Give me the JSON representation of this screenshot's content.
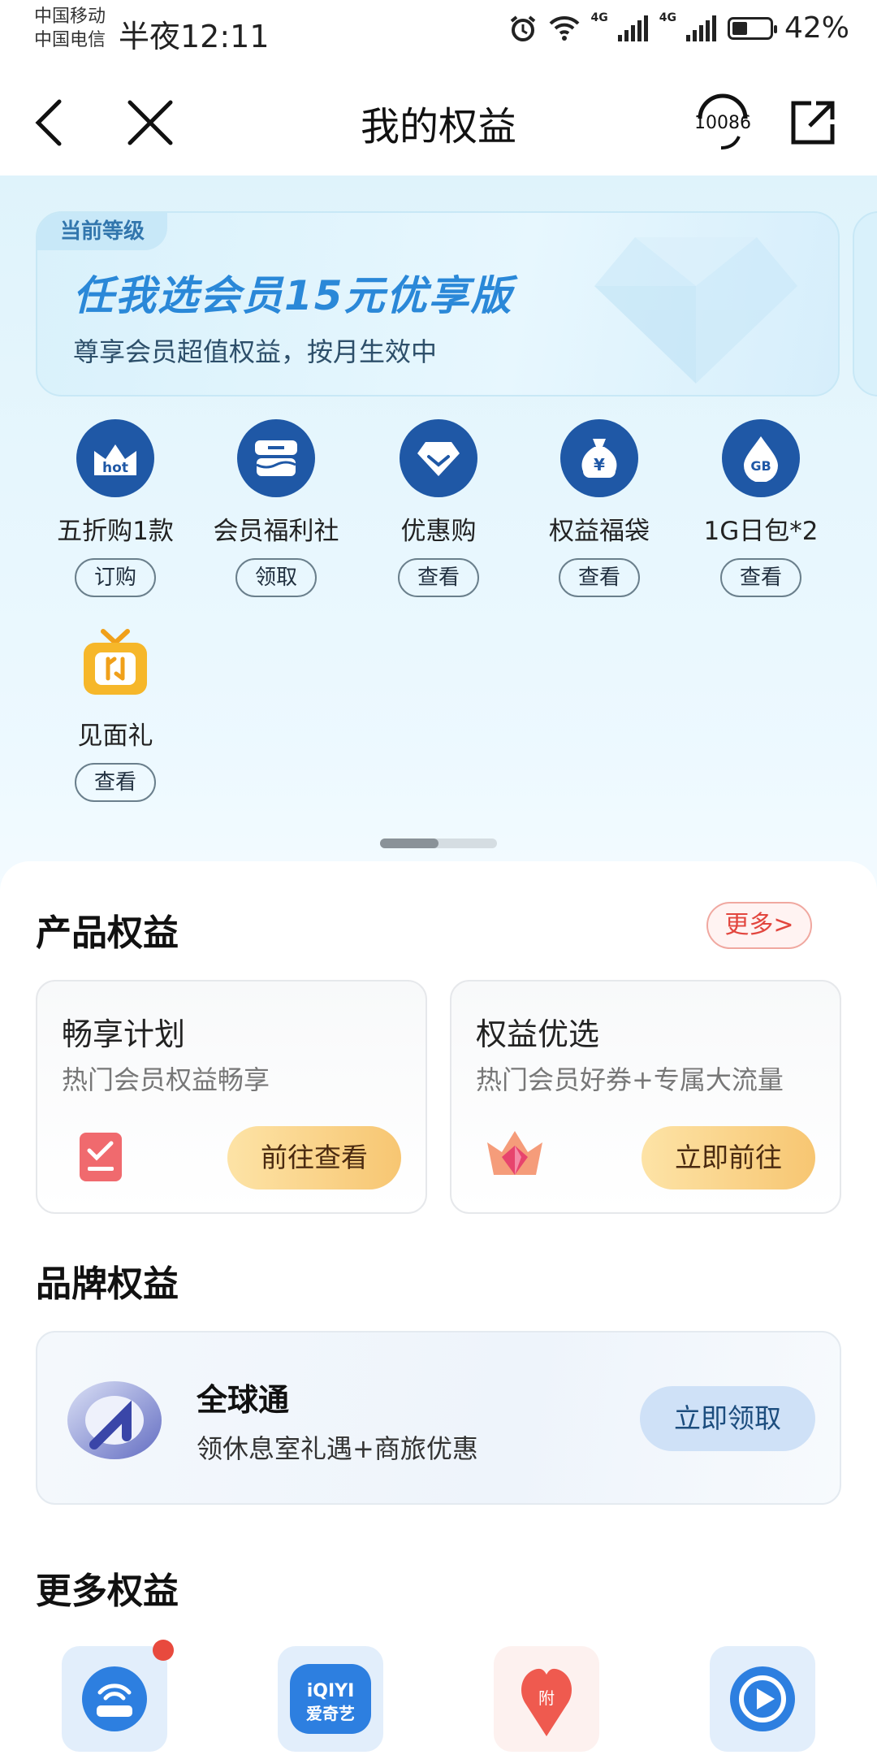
{
  "status_bar": {
    "carrier_1": "中国移动",
    "carrier_2": "中国电信",
    "time": "半夜12:11",
    "network_1": "4G",
    "network_2": "4G",
    "battery_text": "42%",
    "battery_level": 0.42
  },
  "nav": {
    "title": "我的权益",
    "service_number": "10086"
  },
  "level_card": {
    "tag": "当前等级",
    "name": "任我选会员15元优享版",
    "description": "尊享会员超值权益，按月生效中"
  },
  "benefits": [
    {
      "label": "五折购1款",
      "button": "订购",
      "icon": "hot-crown-icon",
      "icon_text": "hot"
    },
    {
      "label": "会员福利社",
      "button": "领取",
      "icon": "gift-box-icon"
    },
    {
      "label": "优惠购",
      "button": "查看",
      "icon": "diamond-icon"
    },
    {
      "label": "权益福袋",
      "button": "查看",
      "icon": "money-bag-icon",
      "icon_text": "¥"
    },
    {
      "label": "1G日包*2",
      "button": "查看",
      "icon": "data-drop-icon",
      "icon_text": "GB"
    },
    {
      "label": "见面礼",
      "button": "查看",
      "icon": "gift-icon"
    }
  ],
  "pager": {
    "pages": 2,
    "current": 1
  },
  "product_section": {
    "title": "产品权益",
    "more_label": "更多>",
    "cards": [
      {
        "title": "畅享计划",
        "description": "热门会员权益畅享",
        "button": "前往查看",
        "icon": "checklist-icon"
      },
      {
        "title": "权益优选",
        "description": "热门会员好券+专属大流量",
        "button": "立即前往",
        "icon": "crown-gem-icon"
      }
    ]
  },
  "brand_section": {
    "title": "品牌权益",
    "card": {
      "name": "全球通",
      "description": "领休息室礼遇+商旅优惠",
      "button": "立即领取",
      "icon": "global-logo-icon"
    }
  },
  "more_section": {
    "title": "更多权益",
    "icons": [
      {
        "name": "router-icon",
        "badge": true
      },
      {
        "name": "iqiyi-icon",
        "text": "iQIYI",
        "subtext": "爱奇艺"
      },
      {
        "name": "heart-tag-icon",
        "text": "附"
      },
      {
        "name": "video-play-icon"
      }
    ]
  },
  "colors": {
    "primary_blue": "#1f58a6",
    "accent_red": "#e2463e",
    "gold": "#f7c672"
  }
}
